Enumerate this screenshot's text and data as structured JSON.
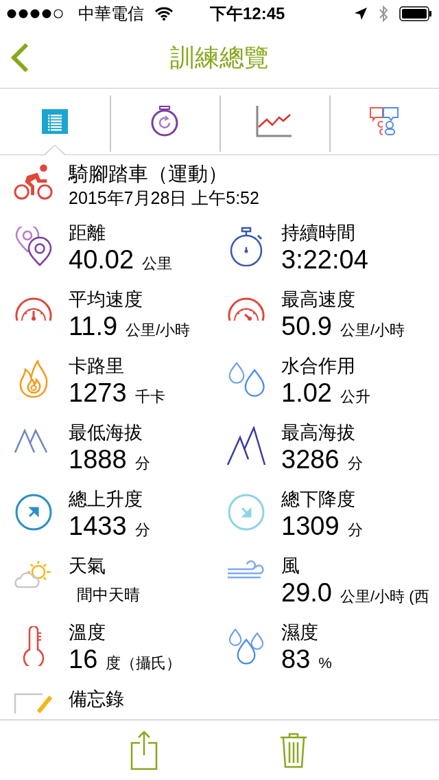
{
  "status_bar": {
    "carrier": "中華電信",
    "time": "下午12:45"
  },
  "nav": {
    "title": "訓練總覽"
  },
  "tabs": [
    {
      "kind": "summary",
      "selected": true
    },
    {
      "kind": "laps",
      "selected": false
    },
    {
      "kind": "chart",
      "selected": false
    },
    {
      "kind": "social",
      "selected": false
    }
  ],
  "activity": {
    "title": "騎腳踏車（運動）",
    "date": "2015年7月28日 上午5:52"
  },
  "metrics": [
    {
      "kind": "pins",
      "label": "距離",
      "value": "40.02",
      "unit": "公里"
    },
    {
      "kind": "stopwatch",
      "label": "持續時間",
      "value": "3:22:04"
    },
    {
      "kind": "gauge-avg",
      "label": "平均速度",
      "value": "11.9",
      "unit": "公里/小時"
    },
    {
      "kind": "gauge-max",
      "label": "最高速度",
      "value": "50.9",
      "unit": "公里/小時"
    },
    {
      "kind": "flame",
      "label": "卡路里",
      "value": "1273",
      "unit": "千卡"
    },
    {
      "kind": "drops",
      "label": "水合作用",
      "value": "1.02",
      "unit": "公升"
    },
    {
      "kind": "mountain-low",
      "label": "最低海拔",
      "value": "1888",
      "unit": "分"
    },
    {
      "kind": "mountain-high",
      "label": "最高海拔",
      "value": "3286",
      "unit": "分"
    },
    {
      "kind": "ascent",
      "label": "總上升度",
      "value": "1433",
      "unit": "分"
    },
    {
      "kind": "descent",
      "label": "總下降度",
      "value": "1309",
      "unit": "分"
    },
    {
      "kind": "weather",
      "label": "天氣",
      "unit": "間中天晴"
    },
    {
      "kind": "wind",
      "label": "風",
      "value": "29.0",
      "unit": "公里/小時 (西"
    },
    {
      "kind": "thermometer",
      "label": "溫度",
      "value": "16",
      "unit": "度（攝氏）"
    },
    {
      "kind": "humidity",
      "label": "濕度",
      "value": "83",
      "unit": "%"
    }
  ],
  "memo": {
    "label": "備忘錄"
  }
}
